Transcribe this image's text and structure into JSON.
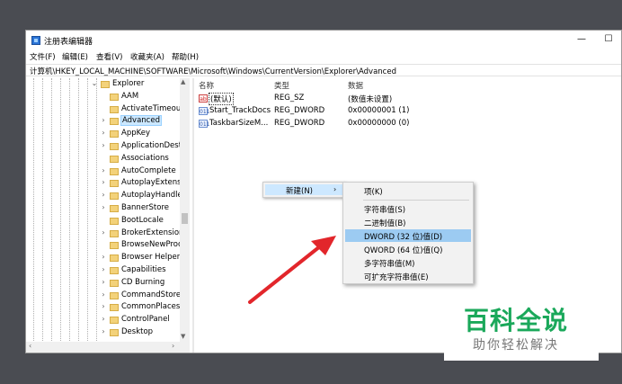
{
  "window": {
    "title": "注册表编辑器",
    "minimize": "—",
    "maximize": "☐"
  },
  "menu": {
    "file": "文件(F)",
    "edit": "编辑(E)",
    "view": "查看(V)",
    "favorites": "收藏夹(A)",
    "help": "帮助(H)"
  },
  "address": "计算机\\HKEY_LOCAL_MACHINE\\SOFTWARE\\Microsoft\\Windows\\CurrentVersion\\Explorer\\Advanced",
  "tree": {
    "items": [
      {
        "label": "Explorer",
        "chev": "⌄"
      },
      {
        "label": "AAM",
        "chev": ""
      },
      {
        "label": "ActivateTimeout",
        "chev": ""
      },
      {
        "label": "Advanced",
        "chev": "›"
      },
      {
        "label": "AppKey",
        "chev": "›"
      },
      {
        "label": "ApplicationDest",
        "chev": "›"
      },
      {
        "label": "Associations",
        "chev": ""
      },
      {
        "label": "AutoComplete",
        "chev": "›"
      },
      {
        "label": "AutoplayExtensi",
        "chev": "›"
      },
      {
        "label": "AutoplayHandle",
        "chev": "›"
      },
      {
        "label": "BannerStore",
        "chev": "›"
      },
      {
        "label": "BootLocale",
        "chev": ""
      },
      {
        "label": "BrokerExtension",
        "chev": "›"
      },
      {
        "label": "BrowseNewProc",
        "chev": ""
      },
      {
        "label": "Browser Helper",
        "chev": "›"
      },
      {
        "label": "Capabilities",
        "chev": "›"
      },
      {
        "label": "CD Burning",
        "chev": "›"
      },
      {
        "label": "CommandStore",
        "chev": "›"
      },
      {
        "label": "CommonPlaces",
        "chev": "›"
      },
      {
        "label": "ControlPanel",
        "chev": "›"
      },
      {
        "label": "Desktop",
        "chev": "›"
      }
    ],
    "selected": "Advanced"
  },
  "list": {
    "headers": {
      "name": "名称",
      "type": "类型",
      "data": "数据"
    },
    "rows": [
      {
        "icon": "ab",
        "name": "(默认)",
        "type": "REG_SZ",
        "data": "(数值未设置)"
      },
      {
        "icon": "011",
        "name": "Start_TrackDocs",
        "type": "REG_DWORD",
        "data": "0x00000001 (1)"
      },
      {
        "icon": "011",
        "name": "TaskbarSizeM...",
        "type": "REG_DWORD",
        "data": "0x00000000 (0)"
      }
    ]
  },
  "context_menu": {
    "new_label": "新建(N)",
    "new_arrow": "›"
  },
  "submenu": {
    "items": [
      "项(K)",
      "字符串值(S)",
      "二进制值(B)",
      "DWORD (32 位)值(D)",
      "QWORD (64 位)值(Q)",
      "多字符串值(M)",
      "可扩充字符串值(E)"
    ],
    "highlighted": "DWORD (32 位)值(D)"
  },
  "watermark": {
    "title": "百科全说",
    "subtitle": "助你轻松解决"
  },
  "colors": {
    "highlight": "#9ccbf2",
    "arrow": "#e2262b",
    "watermark_green": "#1aa85a"
  }
}
